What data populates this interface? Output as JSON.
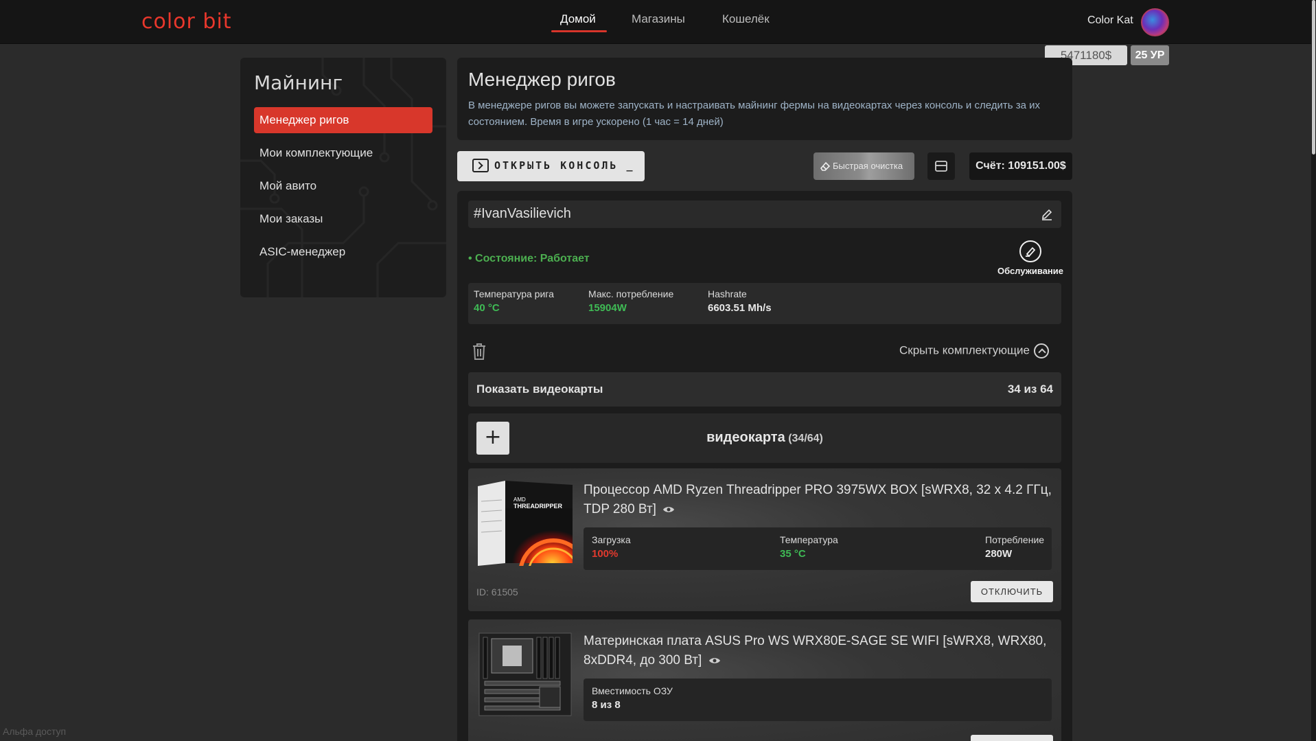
{
  "brand": {
    "logo_text": "color bit",
    "accent": "#e8372c"
  },
  "nav": {
    "items": [
      {
        "label": "Домой",
        "active": true
      },
      {
        "label": "Магазины",
        "active": false
      },
      {
        "label": "Кошелёк",
        "active": false
      }
    ]
  },
  "user": {
    "name": "Color Kat",
    "balance": "5471180$",
    "level": "25 УР"
  },
  "sidebar": {
    "title": "Майнинг",
    "items": [
      {
        "label": "Менеджер ригов",
        "active": true
      },
      {
        "label": "Мои комплектующие"
      },
      {
        "label": "Мой авито"
      },
      {
        "label": "Мои заказы"
      },
      {
        "label": "ASIC-менеджер"
      }
    ]
  },
  "header": {
    "title": "Менеджер ригов",
    "description": "В менеджере ригов вы можете запускать и настраивать майнинг фермы на видеокартах через консоль и следить за их состоянием. Время в игре ускорено (1 час = 14 дней)"
  },
  "toolbar": {
    "console_label": "ОТКРЫТЬ КОНСОЛЬ _",
    "clean_label": "Быстрая очистка",
    "account_label": "Счёт: 109151.00$"
  },
  "rig": {
    "name": "#IvanVasilievich",
    "status": "• Состояние: Работает",
    "service_label": "Обслуживание",
    "metrics": [
      {
        "label": "Температура рига",
        "value": "40 °C",
        "color": "#3fbb55"
      },
      {
        "label": "Макс. потребление",
        "value": "15904W",
        "color": "#3fbb55"
      },
      {
        "label": "Hashrate",
        "value": "6603.51 Mh/s",
        "color": "#e8e8e8"
      }
    ],
    "hide_parts_label": "Скрыть комплектующие",
    "show_gpu": {
      "label": "Показать видеокарты",
      "count": "34 из 64"
    },
    "gpu_section": {
      "title": "видеокарта",
      "count": "(34/64)",
      "add_label": "+"
    }
  },
  "parts": [
    {
      "title": "Процессор AMD Ryzen Threadripper PRO 3975WX BOX [sWRX8, 32 x 4.2 ГГц, TDP 280 Вт]",
      "stats": [
        {
          "label": "Загрузка",
          "value": "100%",
          "color": "#e23a2e"
        },
        {
          "label": "Температура",
          "value": "35 °C",
          "color": "#3fbb55"
        },
        {
          "label": "Потребление",
          "value": "280W",
          "color": "#e8e8e8"
        }
      ],
      "id_label": "ID: 61505",
      "button_label": "ОТКЛЮЧИТЬ"
    },
    {
      "title": "Материнская плата ASUS Pro WS WRX80E-SAGE SE WIFI [sWRX8, WRX80, 8xDDR4, до 300 Вт]",
      "stats": [
        {
          "label": "Вместимость ОЗУ",
          "value": "8 из 8",
          "color": "#e8e8e8"
        }
      ]
    }
  ],
  "footer": {
    "alpha_label": "Альфа доступ"
  }
}
